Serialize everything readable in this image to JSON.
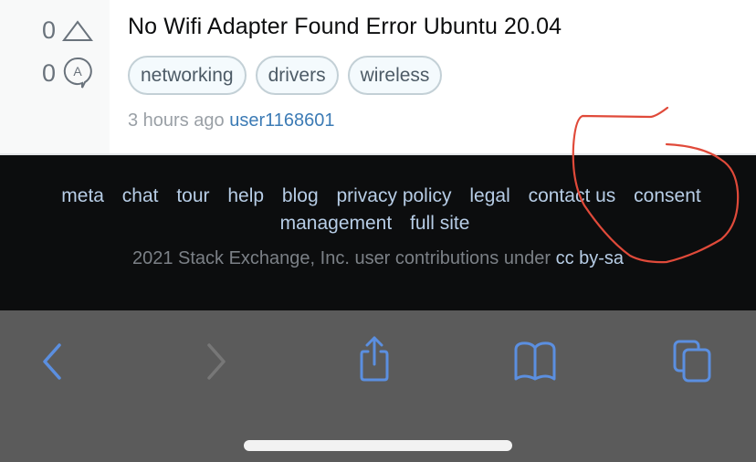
{
  "question": {
    "votes": "0",
    "answers": "0",
    "title": "No Wifi Adapter Found Error Ubuntu 20.04",
    "tags": [
      "networking",
      "drivers",
      "wireless"
    ],
    "time": "3 hours ago",
    "user": "user1168601"
  },
  "footer": {
    "links": [
      "meta",
      "chat",
      "tour",
      "help",
      "blog",
      "privacy policy",
      "legal",
      "contact us",
      "consent management",
      "full site"
    ],
    "copyright_text": "2021 Stack Exchange, Inc. user contributions under",
    "license_link": "cc by-sa"
  },
  "toolbar": {
    "icons": [
      "back-icon",
      "forward-icon",
      "share-icon",
      "bookmarks-icon",
      "tabs-icon"
    ]
  },
  "colors": {
    "accent_blue": "#5b8fe0",
    "link_light": "#b7cde6",
    "annotation_red": "#e04a3a"
  }
}
